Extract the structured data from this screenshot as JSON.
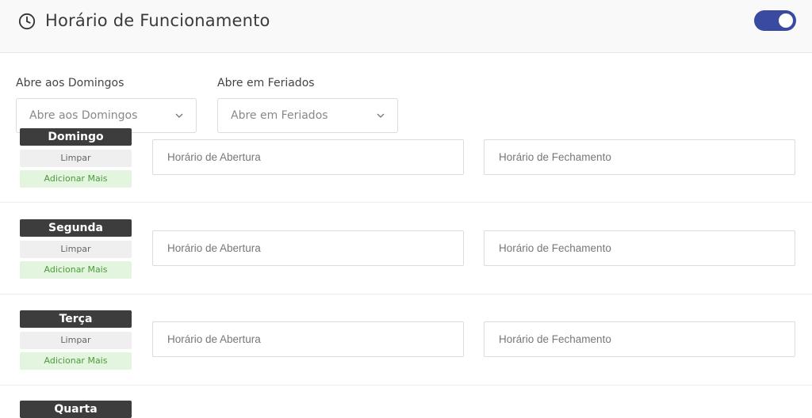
{
  "header": {
    "title": "Horário de Funcionamento",
    "icon": "clock-icon",
    "toggle_on": true,
    "accent_color": "#3a4aa0"
  },
  "selects": [
    {
      "label": "Abre aos Domingos",
      "value": "Abre aos Domingos"
    },
    {
      "label": "Abre em Feriados",
      "value": "Abre em Feriados"
    }
  ],
  "days": [
    {
      "name": "Domingo",
      "clear_label": "Limpar",
      "add_label": "Adicionar Mais",
      "open_placeholder": "Horário de Abertura",
      "close_placeholder": "Horário de Fechamento"
    },
    {
      "name": "Segunda",
      "clear_label": "Limpar",
      "add_label": "Adicionar Mais",
      "open_placeholder": "Horário de Abertura",
      "close_placeholder": "Horário de Fechamento"
    },
    {
      "name": "Terça",
      "clear_label": "Limpar",
      "add_label": "Adicionar Mais",
      "open_placeholder": "Horário de Abertura",
      "close_placeholder": "Horário de Fechamento"
    },
    {
      "name": "Quarta",
      "clear_label": "",
      "add_label": "",
      "open_placeholder": "",
      "close_placeholder": ""
    }
  ]
}
